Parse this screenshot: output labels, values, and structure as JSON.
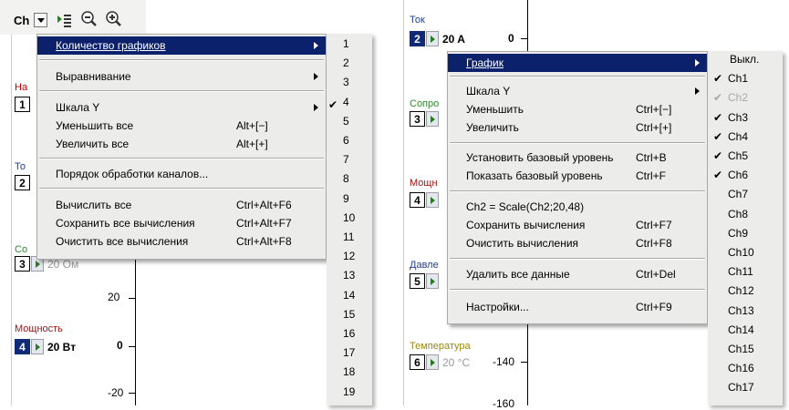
{
  "left": {
    "toolbar": {
      "ch_label": "Ch",
      "icons": [
        "dropdown-arrow-icon",
        "list-icon",
        "zoom-out-icon",
        "zoom-in-icon"
      ]
    },
    "partial_labels": [
      "На",
      "То",
      "Со"
    ],
    "channels": [
      {
        "num": "1",
        "name": "",
        "value": ""
      },
      {
        "num": "2",
        "name": "",
        "value": ""
      },
      {
        "num": "3",
        "name": "",
        "value": "20 Ом"
      },
      {
        "num": "4",
        "name": "Мощность",
        "value": "20 Вт"
      }
    ],
    "ticks": [
      "20",
      "0",
      "-20"
    ],
    "menu": [
      {
        "label": "Количество графиков",
        "shortcut": "",
        "submenu": true,
        "highlight": true
      },
      {
        "label": "Выравнивание",
        "shortcut": "",
        "submenu": true
      },
      {
        "label": "Шкала Y",
        "shortcut": "",
        "submenu": true
      },
      {
        "label": "Уменьшить все",
        "shortcut": "Alt+[−]"
      },
      {
        "label": "Увеличить все",
        "shortcut": "Alt+[+]"
      },
      {
        "label": "Порядок обработки каналов...",
        "shortcut": ""
      },
      {
        "label": "Вычислить все",
        "shortcut": "Ctrl+Alt+F6"
      },
      {
        "label": "Сохранить все вычисления",
        "shortcut": "Ctrl+Alt+F7"
      },
      {
        "label": "Очистить все вычисления",
        "shortcut": "Ctrl+Alt+F8"
      }
    ],
    "count_submenu": [
      "1",
      "2",
      "3",
      "4",
      "5",
      "6",
      "7",
      "8",
      "9",
      "10",
      "11",
      "12",
      "13",
      "14",
      "15",
      "16",
      "17",
      "18",
      "19"
    ],
    "count_checked": "4"
  },
  "right": {
    "channels": [
      {
        "num": "2",
        "name": "Ток",
        "value": "20 A",
        "tick": "0"
      },
      {
        "num": "3",
        "name": "Сопро",
        "value": ""
      },
      {
        "num": "4",
        "name": "Мощн",
        "value": ""
      },
      {
        "num": "5",
        "name": "Давле",
        "value": ""
      },
      {
        "num": "6",
        "name": "Температура",
        "value": "20 °C",
        "tick": "-140"
      }
    ],
    "bottom_tick": "-160",
    "menu": [
      {
        "label": "График",
        "shortcut": "",
        "submenu": true,
        "highlight": true
      },
      {
        "label": "Шкала Y",
        "shortcut": "",
        "submenu": true
      },
      {
        "label": "Уменьшить",
        "shortcut": "Ctrl+[−]"
      },
      {
        "label": "Увеличить",
        "shortcut": "Ctrl+[+]"
      },
      {
        "label": "Установить базовый уровень",
        "shortcut": "Ctrl+B"
      },
      {
        "label": "Показать базовый уровень",
        "shortcut": "Ctrl+F"
      },
      {
        "label": "Ch2 = Scale(Ch2;20,48)",
        "shortcut": ""
      },
      {
        "label": "Сохранить вычисления",
        "shortcut": "Ctrl+F7"
      },
      {
        "label": "Очистить вычисления",
        "shortcut": "Ctrl+F8"
      },
      {
        "label": "Удалить все данные",
        "shortcut": "Ctrl+Del"
      },
      {
        "label": "Настройки...",
        "shortcut": "Ctrl+F9"
      }
    ],
    "graph_submenu": [
      {
        "label": "Выкл.",
        "checked": false,
        "disabled": false
      },
      {
        "label": "Ch1",
        "checked": true,
        "disabled": false
      },
      {
        "label": "Ch2",
        "checked": true,
        "disabled": true
      },
      {
        "label": "Ch3",
        "checked": true,
        "disabled": false
      },
      {
        "label": "Ch4",
        "checked": true,
        "disabled": false
      },
      {
        "label": "Ch5",
        "checked": true,
        "disabled": false
      },
      {
        "label": "Ch6",
        "checked": true,
        "disabled": false
      },
      {
        "label": "Ch7",
        "checked": false,
        "disabled": false
      },
      {
        "label": "Ch8",
        "checked": false,
        "disabled": false
      },
      {
        "label": "Ch9",
        "checked": false,
        "disabled": false
      },
      {
        "label": "Ch10",
        "checked": false,
        "disabled": false
      },
      {
        "label": "Ch11",
        "checked": false,
        "disabled": false
      },
      {
        "label": "Ch12",
        "checked": false,
        "disabled": false
      },
      {
        "label": "Ch13",
        "checked": false,
        "disabled": false
      },
      {
        "label": "Ch14",
        "checked": false,
        "disabled": false
      },
      {
        "label": "Ch15",
        "checked": false,
        "disabled": false
      },
      {
        "label": "Ch16",
        "checked": false,
        "disabled": false
      },
      {
        "label": "Ch17",
        "checked": false,
        "disabled": false
      }
    ]
  },
  "colors": {
    "highlight": "#0c216c",
    "menu_bg": "#ececea",
    "ch_num_selected": "#102a78",
    "label_red": "#c00000",
    "label_blue": "#1e3c96",
    "label_green": "#2a8a2a",
    "label_brown": "#9a1010"
  }
}
